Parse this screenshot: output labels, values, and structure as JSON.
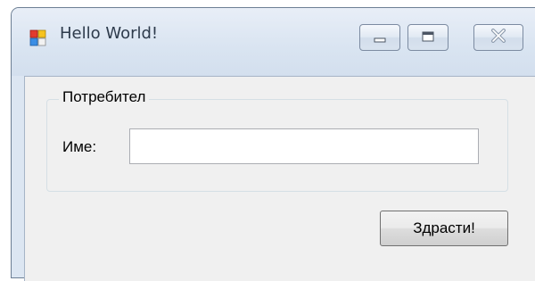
{
  "window": {
    "title": "Hello World!",
    "icon": "app-window-icon",
    "controls": {
      "minimize_icon": "minimize-icon",
      "maximize_icon": "maximize-icon",
      "close_icon": "close-icon"
    }
  },
  "form": {
    "group_title": "Потребител",
    "name_label": "Име:",
    "name_value": "",
    "submit_label": "Здрасти!"
  },
  "colors": {
    "title_bar": "#dce6f2",
    "client_bg": "#f0f0f0",
    "close_glyph": "#9aa7b8"
  }
}
